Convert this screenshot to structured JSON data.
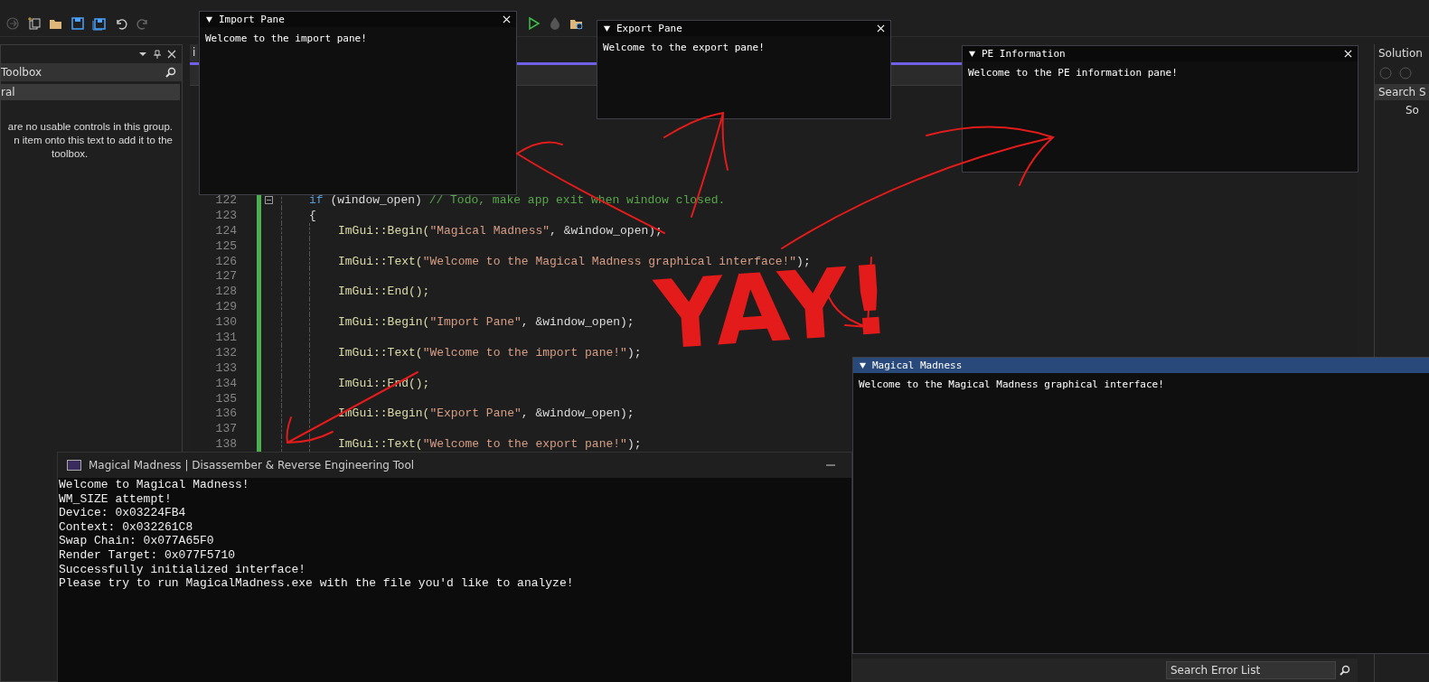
{
  "toolbox": {
    "title": "Toolbox",
    "group": "ral",
    "message": [
      "are no usable controls in this group.",
      "n item onto this text to add it to the",
      "toolbox."
    ]
  },
  "editor": {
    "tab": "i",
    "lines": [
      {
        "num": "122",
        "kind": "outer",
        "tokens": [
          {
            "text": "if",
            "kind": "kw"
          },
          {
            "text": " (window_open) ",
            "kind": "plain"
          },
          {
            "text": "// Todo, make app exit when window closed.",
            "kind": "comment"
          }
        ]
      },
      {
        "num": "123",
        "kind": "outer",
        "tokens": [
          {
            "text": "{",
            "kind": "plain"
          }
        ]
      },
      {
        "num": "124",
        "kind": "inner",
        "tokens": [
          {
            "text": "ImGui::Begin(",
            "kind": "fn"
          },
          {
            "text": "\"Magical Madness\"",
            "kind": "str"
          },
          {
            "text": ", &window_open);",
            "kind": "plain"
          }
        ]
      },
      {
        "num": "125",
        "kind": "inner"
      },
      {
        "num": "126",
        "kind": "inner",
        "tokens": [
          {
            "text": "ImGui::Text(",
            "kind": "fn"
          },
          {
            "text": "\"Welcome to the Magical Madness graphical interface!\"",
            "kind": "str"
          },
          {
            "text": ");",
            "kind": "plain"
          }
        ]
      },
      {
        "num": "127",
        "kind": "inner"
      },
      {
        "num": "128",
        "kind": "inner",
        "tokens": [
          {
            "text": "ImGui::End();",
            "kind": "fn"
          }
        ]
      },
      {
        "num": "129",
        "kind": "inner"
      },
      {
        "num": "130",
        "kind": "inner",
        "tokens": [
          {
            "text": "ImGui::Begin(",
            "kind": "fn"
          },
          {
            "text": "\"Import Pane\"",
            "kind": "str"
          },
          {
            "text": ", &window_open);",
            "kind": "plain"
          }
        ]
      },
      {
        "num": "131",
        "kind": "inner"
      },
      {
        "num": "132",
        "kind": "inner",
        "tokens": [
          {
            "text": "ImGui::Text(",
            "kind": "fn"
          },
          {
            "text": "\"Welcome to the import pane!\"",
            "kind": "str"
          },
          {
            "text": ");",
            "kind": "plain"
          }
        ]
      },
      {
        "num": "133",
        "kind": "inner"
      },
      {
        "num": "134",
        "kind": "inner",
        "tokens": [
          {
            "text": "ImGui::End();",
            "kind": "fn"
          }
        ]
      },
      {
        "num": "135",
        "kind": "inner"
      },
      {
        "num": "136",
        "kind": "inner",
        "tokens": [
          {
            "text": "ImGui::Begin(",
            "kind": "fn"
          },
          {
            "text": "\"Export Pane\"",
            "kind": "str"
          },
          {
            "text": ", &window_open);",
            "kind": "plain"
          }
        ]
      },
      {
        "num": "137",
        "kind": "inner"
      },
      {
        "num": "138",
        "kind": "inner",
        "tokens": [
          {
            "text": "ImGui::Text(",
            "kind": "fn"
          },
          {
            "text": "\"Welcome to the export pane!\"",
            "kind": "str"
          },
          {
            "text": ");",
            "kind": "plain"
          }
        ]
      }
    ]
  },
  "solution_explorer": {
    "title": "Solution",
    "search": "Search S",
    "root": "So"
  },
  "error_list": {
    "search_placeholder": "Search Error List"
  },
  "console": {
    "title": "Magical Madness | Disassember & Reverse Engineering Tool",
    "lines": [
      "Welcome to Magical Madness!",
      "WM_SIZE attempt!",
      "Device: 0x03224FB4",
      "Context: 0x032261C8",
      "Swap Chain: 0x077A65F0",
      "Render Target: 0x077F5710",
      "Successfully initialized interface!",
      "Please try to run MagicalMadness.exe with the file you'd like to analyze!"
    ]
  },
  "panes": [
    {
      "kind": "import",
      "title": "Import Pane",
      "text": "Welcome to the import pane!",
      "selected": false
    },
    {
      "kind": "export",
      "title": "Export Pane",
      "text": "Welcome to the export pane!",
      "selected": false
    },
    {
      "kind": "pe",
      "title": "PE Information",
      "text": "Welcome to the PE information pane!",
      "selected": false
    },
    {
      "kind": "main",
      "title": "Magical Madness",
      "text": "Welcome to the Magical Madness graphical interface!",
      "selected": true
    }
  ],
  "annotation": {
    "text": "YAY!"
  }
}
